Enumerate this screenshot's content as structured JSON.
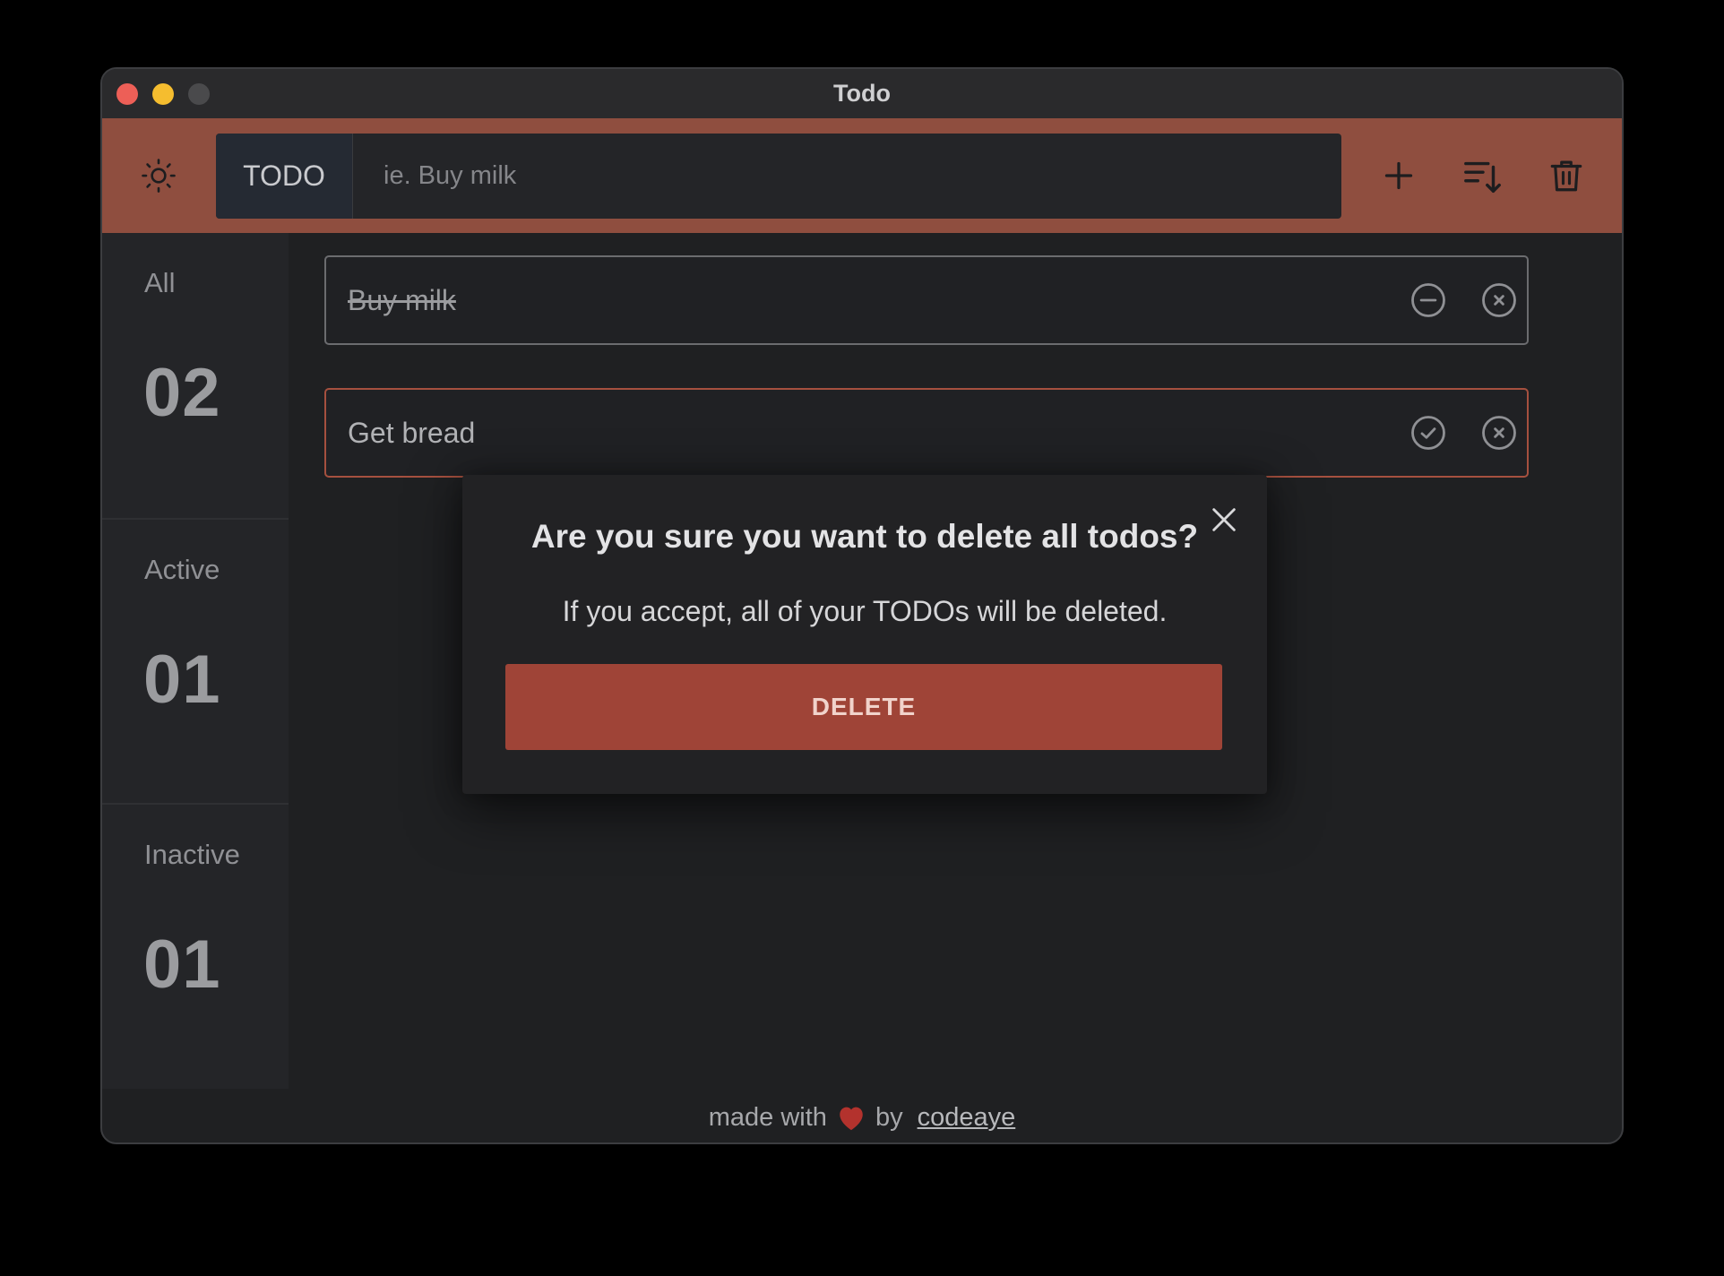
{
  "window": {
    "title": "Todo"
  },
  "toolbar": {
    "theme_icon": "sun-icon",
    "input_prefix": "TODO",
    "input_placeholder": "ie. Buy milk",
    "add_icon": "plus-icon",
    "sort_icon": "sort-icon",
    "delete_all_icon": "trash-icon"
  },
  "sidebar": {
    "stats": [
      {
        "label": "All",
        "count": "02"
      },
      {
        "label": "Active",
        "count": "01"
      },
      {
        "label": "Inactive",
        "count": "01"
      }
    ]
  },
  "todos": [
    {
      "text": "Buy milk",
      "completed": true,
      "toggle_icon": "minus-circle-icon",
      "remove_icon": "x-circle-icon"
    },
    {
      "text": "Get bread",
      "completed": false,
      "toggle_icon": "check-circle-icon",
      "remove_icon": "x-circle-icon"
    }
  ],
  "modal": {
    "title": "Are you sure you want to delete all todos?",
    "message": "If you accept, all of your TODOs will be deleted.",
    "delete_label": "DELETE",
    "close_icon": "close-icon"
  },
  "footer": {
    "prefix": "made with",
    "heart_icon": "heart-icon",
    "by": "by",
    "link": "codeaye"
  },
  "colors": {
    "toolbar": "#8f4e3f",
    "delete_button": "#9f4437",
    "active_border": "#a5503f",
    "background": "#1f2022"
  }
}
